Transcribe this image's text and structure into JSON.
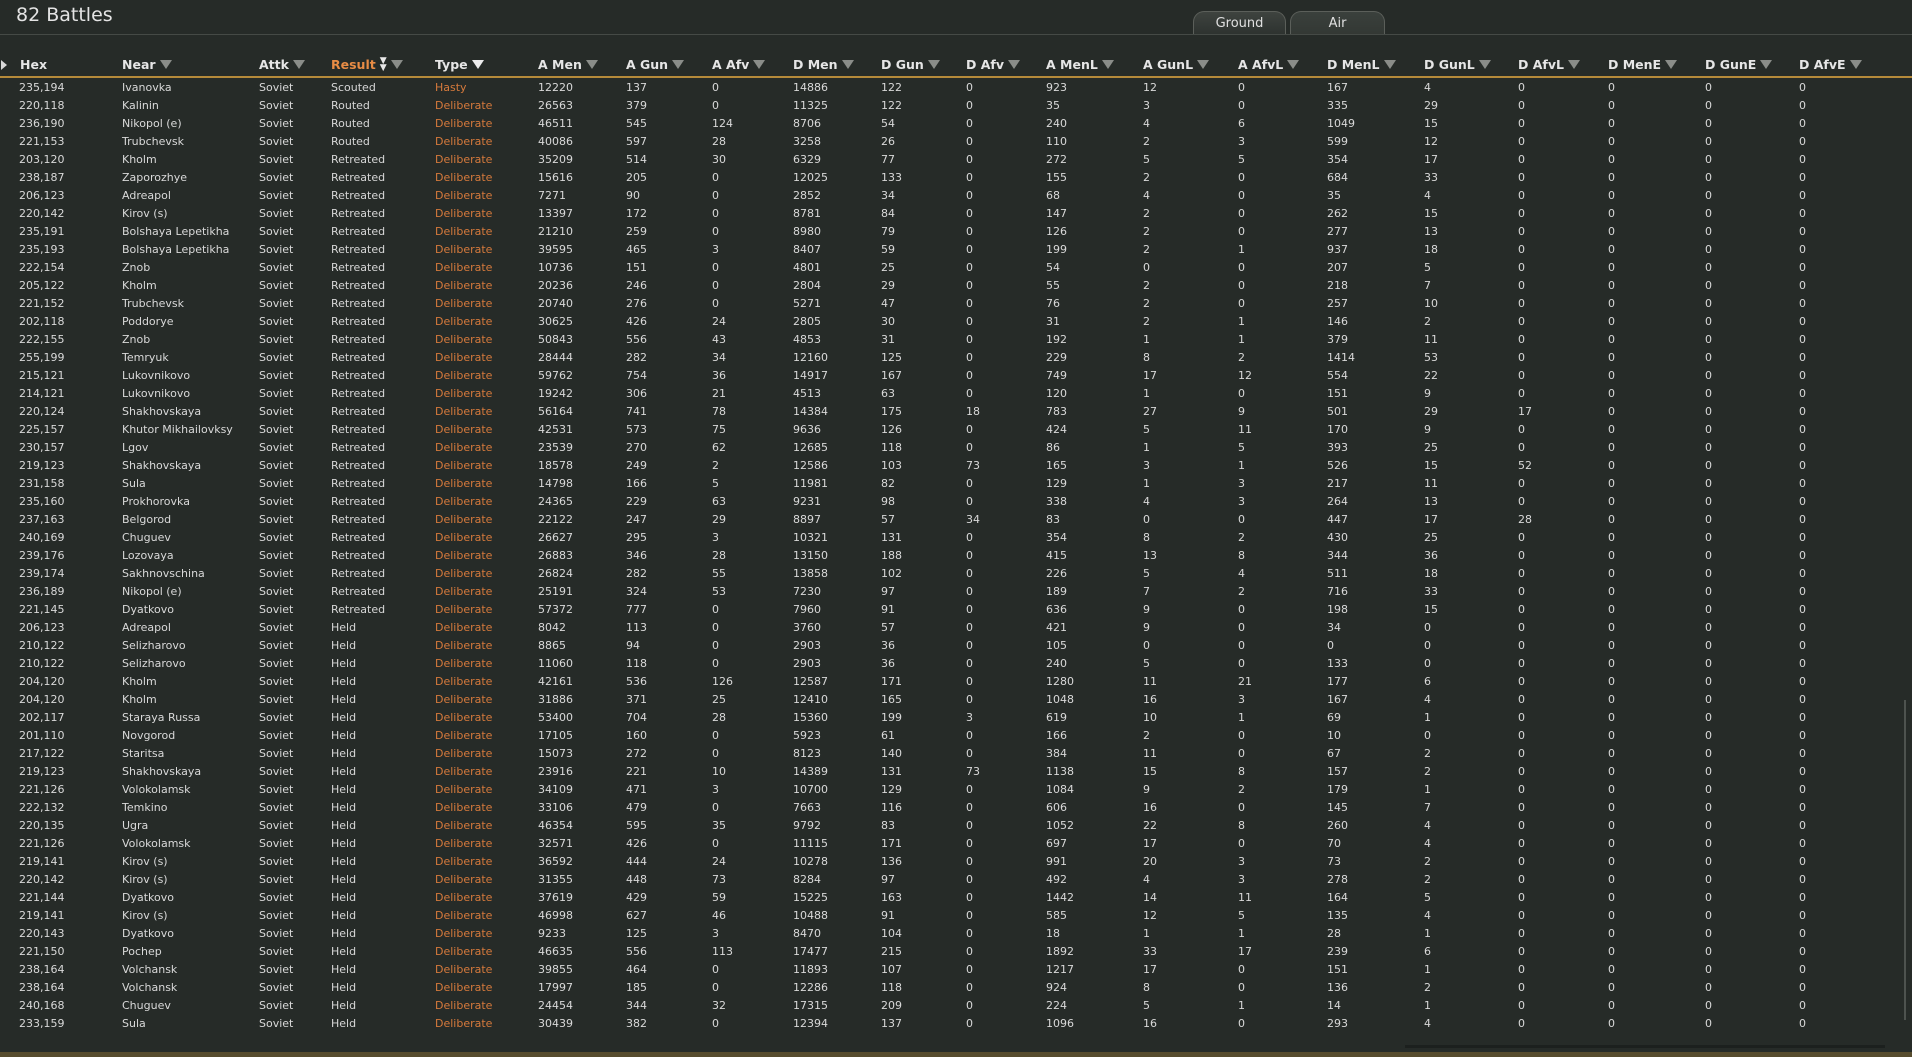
{
  "title": "82 Battles",
  "tabs": [
    {
      "label": "Ground",
      "active": true
    },
    {
      "label": "Air",
      "active": false
    }
  ],
  "colors": {
    "accent": "#b58a3a",
    "type_text": "#d67a3c",
    "sorted_header": "#e88c45"
  },
  "columns": [
    {
      "label": "Hex",
      "filter": false
    },
    {
      "label": "Near",
      "filter": true
    },
    {
      "label": "Attk",
      "filter": true
    },
    {
      "label": "Result",
      "filter": true,
      "sort": "descending"
    },
    {
      "label": "Type",
      "filter": true,
      "filter_active": true
    },
    {
      "label": "A Men",
      "filter": true
    },
    {
      "label": "A Gun",
      "filter": true
    },
    {
      "label": "A Afv",
      "filter": true
    },
    {
      "label": "D Men",
      "filter": true
    },
    {
      "label": "D Gun",
      "filter": true
    },
    {
      "label": "D Afv",
      "filter": true
    },
    {
      "label": "A MenL",
      "filter": true
    },
    {
      "label": "A GunL",
      "filter": true
    },
    {
      "label": "A AfvL",
      "filter": true
    },
    {
      "label": "D MenL",
      "filter": true
    },
    {
      "label": "D GunL",
      "filter": true
    },
    {
      "label": "D AfvL",
      "filter": true
    },
    {
      "label": "D MenE",
      "filter": true
    },
    {
      "label": "D GunE",
      "filter": true
    },
    {
      "label": "D AfvE",
      "filter": true
    }
  ],
  "rows": [
    [
      "235,194",
      "Ivanovka",
      "Soviet",
      "Scouted",
      "Hasty",
      "12220",
      "137",
      "0",
      "14886",
      "122",
      "0",
      "923",
      "12",
      "0",
      "167",
      "4",
      "0",
      "0",
      "0",
      "0"
    ],
    [
      "220,118",
      "Kalinin",
      "Soviet",
      "Routed",
      "Deliberate",
      "26563",
      "379",
      "0",
      "11325",
      "122",
      "0",
      "35",
      "3",
      "0",
      "335",
      "29",
      "0",
      "0",
      "0",
      "0"
    ],
    [
      "236,190",
      "Nikopol (e)",
      "Soviet",
      "Routed",
      "Deliberate",
      "46511",
      "545",
      "124",
      "8706",
      "54",
      "0",
      "240",
      "4",
      "6",
      "1049",
      "15",
      "0",
      "0",
      "0",
      "0"
    ],
    [
      "221,153",
      "Trubchevsk",
      "Soviet",
      "Routed",
      "Deliberate",
      "40086",
      "597",
      "28",
      "3258",
      "26",
      "0",
      "110",
      "2",
      "3",
      "599",
      "12",
      "0",
      "0",
      "0",
      "0"
    ],
    [
      "203,120",
      "Kholm",
      "Soviet",
      "Retreated",
      "Deliberate",
      "35209",
      "514",
      "30",
      "6329",
      "77",
      "0",
      "272",
      "5",
      "5",
      "354",
      "17",
      "0",
      "0",
      "0",
      "0"
    ],
    [
      "238,187",
      "Zaporozhye",
      "Soviet",
      "Retreated",
      "Deliberate",
      "15616",
      "205",
      "0",
      "12025",
      "133",
      "0",
      "155",
      "2",
      "0",
      "684",
      "33",
      "0",
      "0",
      "0",
      "0"
    ],
    [
      "206,123",
      "Adreapol",
      "Soviet",
      "Retreated",
      "Deliberate",
      "7271",
      "90",
      "0",
      "2852",
      "34",
      "0",
      "68",
      "4",
      "0",
      "35",
      "4",
      "0",
      "0",
      "0",
      "0"
    ],
    [
      "220,142",
      "Kirov (s)",
      "Soviet",
      "Retreated",
      "Deliberate",
      "13397",
      "172",
      "0",
      "8781",
      "84",
      "0",
      "147",
      "2",
      "0",
      "262",
      "15",
      "0",
      "0",
      "0",
      "0"
    ],
    [
      "235,191",
      "Bolshaya Lepetikha",
      "Soviet",
      "Retreated",
      "Deliberate",
      "21210",
      "259",
      "0",
      "8980",
      "79",
      "0",
      "126",
      "2",
      "0",
      "277",
      "13",
      "0",
      "0",
      "0",
      "0"
    ],
    [
      "235,193",
      "Bolshaya Lepetikha",
      "Soviet",
      "Retreated",
      "Deliberate",
      "39595",
      "465",
      "3",
      "8407",
      "59",
      "0",
      "199",
      "2",
      "1",
      "937",
      "18",
      "0",
      "0",
      "0",
      "0"
    ],
    [
      "222,154",
      "Znob",
      "Soviet",
      "Retreated",
      "Deliberate",
      "10736",
      "151",
      "0",
      "4801",
      "25",
      "0",
      "54",
      "0",
      "0",
      "207",
      "5",
      "0",
      "0",
      "0",
      "0"
    ],
    [
      "205,122",
      "Kholm",
      "Soviet",
      "Retreated",
      "Deliberate",
      "20236",
      "246",
      "0",
      "2804",
      "29",
      "0",
      "55",
      "2",
      "0",
      "218",
      "7",
      "0",
      "0",
      "0",
      "0"
    ],
    [
      "221,152",
      "Trubchevsk",
      "Soviet",
      "Retreated",
      "Deliberate",
      "20740",
      "276",
      "0",
      "5271",
      "47",
      "0",
      "76",
      "2",
      "0",
      "257",
      "10",
      "0",
      "0",
      "0",
      "0"
    ],
    [
      "202,118",
      "Poddorye",
      "Soviet",
      "Retreated",
      "Deliberate",
      "30625",
      "426",
      "24",
      "2805",
      "30",
      "0",
      "31",
      "2",
      "1",
      "146",
      "2",
      "0",
      "0",
      "0",
      "0"
    ],
    [
      "222,155",
      "Znob",
      "Soviet",
      "Retreated",
      "Deliberate",
      "50843",
      "556",
      "43",
      "4853",
      "31",
      "0",
      "192",
      "1",
      "1",
      "379",
      "11",
      "0",
      "0",
      "0",
      "0"
    ],
    [
      "255,199",
      "Temryuk",
      "Soviet",
      "Retreated",
      "Deliberate",
      "28444",
      "282",
      "34",
      "12160",
      "125",
      "0",
      "229",
      "8",
      "2",
      "1414",
      "53",
      "0",
      "0",
      "0",
      "0"
    ],
    [
      "215,121",
      "Lukovnikovo",
      "Soviet",
      "Retreated",
      "Deliberate",
      "59762",
      "754",
      "36",
      "14917",
      "167",
      "0",
      "749",
      "17",
      "12",
      "554",
      "22",
      "0",
      "0",
      "0",
      "0"
    ],
    [
      "214,121",
      "Lukovnikovo",
      "Soviet",
      "Retreated",
      "Deliberate",
      "19242",
      "306",
      "21",
      "4513",
      "63",
      "0",
      "120",
      "1",
      "0",
      "151",
      "9",
      "0",
      "0",
      "0",
      "0"
    ],
    [
      "220,124",
      "Shakhovskaya",
      "Soviet",
      "Retreated",
      "Deliberate",
      "56164",
      "741",
      "78",
      "14384",
      "175",
      "18",
      "783",
      "27",
      "9",
      "501",
      "29",
      "17",
      "0",
      "0",
      "0"
    ],
    [
      "225,157",
      "Khutor Mikhailovksy",
      "Soviet",
      "Retreated",
      "Deliberate",
      "42531",
      "573",
      "75",
      "9636",
      "126",
      "0",
      "424",
      "5",
      "11",
      "170",
      "9",
      "0",
      "0",
      "0",
      "0"
    ],
    [
      "230,157",
      "Lgov",
      "Soviet",
      "Retreated",
      "Deliberate",
      "23539",
      "270",
      "62",
      "12685",
      "118",
      "0",
      "86",
      "1",
      "5",
      "393",
      "25",
      "0",
      "0",
      "0",
      "0"
    ],
    [
      "219,123",
      "Shakhovskaya",
      "Soviet",
      "Retreated",
      "Deliberate",
      "18578",
      "249",
      "2",
      "12586",
      "103",
      "73",
      "165",
      "3",
      "1",
      "526",
      "15",
      "52",
      "0",
      "0",
      "0"
    ],
    [
      "231,158",
      "Sula",
      "Soviet",
      "Retreated",
      "Deliberate",
      "14798",
      "166",
      "5",
      "11981",
      "82",
      "0",
      "129",
      "1",
      "3",
      "217",
      "11",
      "0",
      "0",
      "0",
      "0"
    ],
    [
      "235,160",
      "Prokhorovka",
      "Soviet",
      "Retreated",
      "Deliberate",
      "24365",
      "229",
      "63",
      "9231",
      "98",
      "0",
      "338",
      "4",
      "3",
      "264",
      "13",
      "0",
      "0",
      "0",
      "0"
    ],
    [
      "237,163",
      "Belgorod",
      "Soviet",
      "Retreated",
      "Deliberate",
      "22122",
      "247",
      "29",
      "8897",
      "57",
      "34",
      "83",
      "0",
      "0",
      "447",
      "17",
      "28",
      "0",
      "0",
      "0"
    ],
    [
      "240,169",
      "Chuguev",
      "Soviet",
      "Retreated",
      "Deliberate",
      "26627",
      "295",
      "3",
      "10321",
      "131",
      "0",
      "354",
      "8",
      "2",
      "430",
      "25",
      "0",
      "0",
      "0",
      "0"
    ],
    [
      "239,176",
      "Lozovaya",
      "Soviet",
      "Retreated",
      "Deliberate",
      "26883",
      "346",
      "28",
      "13150",
      "188",
      "0",
      "415",
      "13",
      "8",
      "344",
      "36",
      "0",
      "0",
      "0",
      "0"
    ],
    [
      "239,174",
      "Sakhnovschina",
      "Soviet",
      "Retreated",
      "Deliberate",
      "26824",
      "282",
      "55",
      "13858",
      "102",
      "0",
      "226",
      "5",
      "4",
      "511",
      "18",
      "0",
      "0",
      "0",
      "0"
    ],
    [
      "236,189",
      "Nikopol (e)",
      "Soviet",
      "Retreated",
      "Deliberate",
      "25191",
      "324",
      "53",
      "7230",
      "97",
      "0",
      "189",
      "7",
      "2",
      "716",
      "33",
      "0",
      "0",
      "0",
      "0"
    ],
    [
      "221,145",
      "Dyatkovo",
      "Soviet",
      "Retreated",
      "Deliberate",
      "57372",
      "777",
      "0",
      "7960",
      "91",
      "0",
      "636",
      "9",
      "0",
      "198",
      "15",
      "0",
      "0",
      "0",
      "0"
    ],
    [
      "206,123",
      "Adreapol",
      "Soviet",
      "Held",
      "Deliberate",
      "8042",
      "113",
      "0",
      "3760",
      "57",
      "0",
      "421",
      "9",
      "0",
      "34",
      "0",
      "0",
      "0",
      "0",
      "0"
    ],
    [
      "210,122",
      "Selizharovo",
      "Soviet",
      "Held",
      "Deliberate",
      "8865",
      "94",
      "0",
      "2903",
      "36",
      "0",
      "105",
      "0",
      "0",
      "0",
      "0",
      "0",
      "0",
      "0",
      "0"
    ],
    [
      "210,122",
      "Selizharovo",
      "Soviet",
      "Held",
      "Deliberate",
      "11060",
      "118",
      "0",
      "2903",
      "36",
      "0",
      "240",
      "5",
      "0",
      "133",
      "0",
      "0",
      "0",
      "0",
      "0"
    ],
    [
      "204,120",
      "Kholm",
      "Soviet",
      "Held",
      "Deliberate",
      "42161",
      "536",
      "126",
      "12587",
      "171",
      "0",
      "1280",
      "11",
      "21",
      "177",
      "6",
      "0",
      "0",
      "0",
      "0"
    ],
    [
      "204,120",
      "Kholm",
      "Soviet",
      "Held",
      "Deliberate",
      "31886",
      "371",
      "25",
      "12410",
      "165",
      "0",
      "1048",
      "16",
      "3",
      "167",
      "4",
      "0",
      "0",
      "0",
      "0"
    ],
    [
      "202,117",
      "Staraya Russa",
      "Soviet",
      "Held",
      "Deliberate",
      "53400",
      "704",
      "28",
      "15360",
      "199",
      "3",
      "619",
      "10",
      "1",
      "69",
      "1",
      "0",
      "0",
      "0",
      "0"
    ],
    [
      "201,110",
      "Novgorod",
      "Soviet",
      "Held",
      "Deliberate",
      "17105",
      "160",
      "0",
      "5923",
      "61",
      "0",
      "166",
      "2",
      "0",
      "10",
      "0",
      "0",
      "0",
      "0",
      "0"
    ],
    [
      "217,122",
      "Staritsa",
      "Soviet",
      "Held",
      "Deliberate",
      "15073",
      "272",
      "0",
      "8123",
      "140",
      "0",
      "384",
      "11",
      "0",
      "67",
      "2",
      "0",
      "0",
      "0",
      "0"
    ],
    [
      "219,123",
      "Shakhovskaya",
      "Soviet",
      "Held",
      "Deliberate",
      "23916",
      "221",
      "10",
      "14389",
      "131",
      "73",
      "1138",
      "15",
      "8",
      "157",
      "2",
      "0",
      "0",
      "0",
      "0"
    ],
    [
      "221,126",
      "Volokolamsk",
      "Soviet",
      "Held",
      "Deliberate",
      "34109",
      "471",
      "3",
      "10700",
      "129",
      "0",
      "1084",
      "9",
      "2",
      "179",
      "1",
      "0",
      "0",
      "0",
      "0"
    ],
    [
      "222,132",
      "Temkino",
      "Soviet",
      "Held",
      "Deliberate",
      "33106",
      "479",
      "0",
      "7663",
      "116",
      "0",
      "606",
      "16",
      "0",
      "145",
      "7",
      "0",
      "0",
      "0",
      "0"
    ],
    [
      "220,135",
      "Ugra",
      "Soviet",
      "Held",
      "Deliberate",
      "46354",
      "595",
      "35",
      "9792",
      "83",
      "0",
      "1052",
      "22",
      "8",
      "260",
      "4",
      "0",
      "0",
      "0",
      "0"
    ],
    [
      "221,126",
      "Volokolamsk",
      "Soviet",
      "Held",
      "Deliberate",
      "32571",
      "426",
      "0",
      "11115",
      "171",
      "0",
      "697",
      "17",
      "0",
      "70",
      "4",
      "0",
      "0",
      "0",
      "0"
    ],
    [
      "219,141",
      "Kirov (s)",
      "Soviet",
      "Held",
      "Deliberate",
      "36592",
      "444",
      "24",
      "10278",
      "136",
      "0",
      "991",
      "20",
      "3",
      "73",
      "2",
      "0",
      "0",
      "0",
      "0"
    ],
    [
      "220,142",
      "Kirov (s)",
      "Soviet",
      "Held",
      "Deliberate",
      "31355",
      "448",
      "73",
      "8284",
      "97",
      "0",
      "492",
      "4",
      "3",
      "278",
      "2",
      "0",
      "0",
      "0",
      "0"
    ],
    [
      "221,144",
      "Dyatkovo",
      "Soviet",
      "Held",
      "Deliberate",
      "37619",
      "429",
      "59",
      "15225",
      "163",
      "0",
      "1442",
      "14",
      "11",
      "164",
      "5",
      "0",
      "0",
      "0",
      "0"
    ],
    [
      "219,141",
      "Kirov (s)",
      "Soviet",
      "Held",
      "Deliberate",
      "46998",
      "627",
      "46",
      "10488",
      "91",
      "0",
      "585",
      "12",
      "5",
      "135",
      "4",
      "0",
      "0",
      "0",
      "0"
    ],
    [
      "220,143",
      "Dyatkovo",
      "Soviet",
      "Held",
      "Deliberate",
      "9233",
      "125",
      "3",
      "8470",
      "104",
      "0",
      "18",
      "1",
      "1",
      "28",
      "1",
      "0",
      "0",
      "0",
      "0"
    ],
    [
      "221,150",
      "Pochep",
      "Soviet",
      "Held",
      "Deliberate",
      "46635",
      "556",
      "113",
      "17477",
      "215",
      "0",
      "1892",
      "33",
      "17",
      "239",
      "6",
      "0",
      "0",
      "0",
      "0"
    ],
    [
      "238,164",
      "Volchansk",
      "Soviet",
      "Held",
      "Deliberate",
      "39855",
      "464",
      "0",
      "11893",
      "107",
      "0",
      "1217",
      "17",
      "0",
      "151",
      "1",
      "0",
      "0",
      "0",
      "0"
    ],
    [
      "238,164",
      "Volchansk",
      "Soviet",
      "Held",
      "Deliberate",
      "17997",
      "185",
      "0",
      "12286",
      "118",
      "0",
      "924",
      "8",
      "0",
      "136",
      "2",
      "0",
      "0",
      "0",
      "0"
    ],
    [
      "240,168",
      "Chuguev",
      "Soviet",
      "Held",
      "Deliberate",
      "24454",
      "344",
      "32",
      "17315",
      "209",
      "0",
      "224",
      "5",
      "1",
      "14",
      "1",
      "0",
      "0",
      "0",
      "0"
    ],
    [
      "233,159",
      "Sula",
      "Soviet",
      "Held",
      "Deliberate",
      "30439",
      "382",
      "0",
      "12394",
      "137",
      "0",
      "1096",
      "16",
      "0",
      "293",
      "4",
      "0",
      "0",
      "0",
      "0"
    ]
  ]
}
